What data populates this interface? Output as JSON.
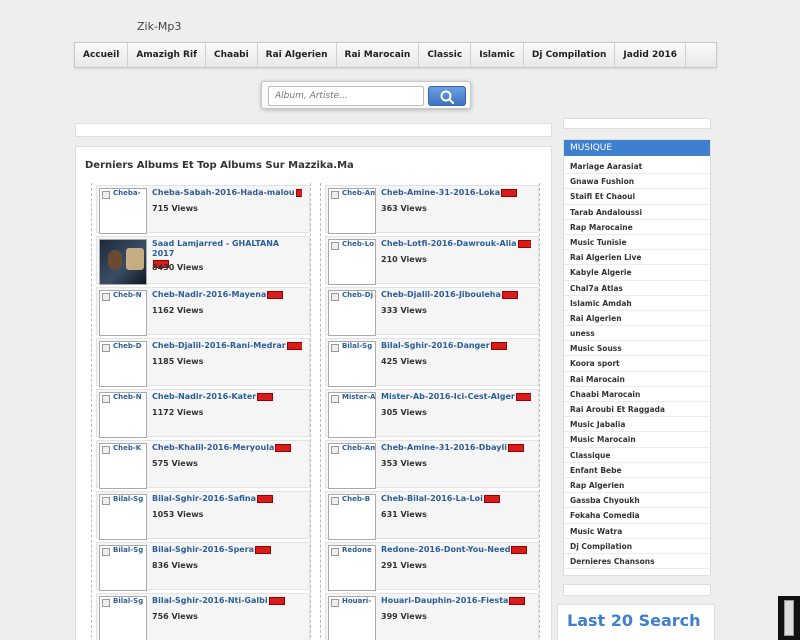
{
  "site_title": "Zik-Mp3",
  "nav": [
    "Accueil",
    "Amazigh Rif",
    "Chaabi",
    "Rai Algerien",
    "Rai Marocain",
    "Classic",
    "Islamic",
    "Dj Compilation",
    "Jadid 2016"
  ],
  "search": {
    "placeholder": "Album, Artiste...",
    "icon": "search-icon"
  },
  "main_heading": "Derniers Albums Et Top Albums Sur Mazzika.Ma",
  "left_items": [
    {
      "thumb": "Cheba-",
      "title": "Cheba-Sabah-2016-Hada-malou",
      "views": "715 Views"
    },
    {
      "thumb": "",
      "title": "Saad Lamjarred - GHALTANA 2017",
      "views": "8430 Views",
      "photo": true
    },
    {
      "thumb": "Cheb-N",
      "title": "Cheb-Nadir-2016-Mayena",
      "views": "1162 Views"
    },
    {
      "thumb": "Cheb-D",
      "title": "Cheb-Djalil-2016-Rani-Medrar",
      "views": "1185 Views"
    },
    {
      "thumb": "Cheb-N",
      "title": "Cheb-Nadir-2016-Kater",
      "views": "1172 Views"
    },
    {
      "thumb": "Cheb-K",
      "title": "Cheb-Khalil-2016-Meryoula",
      "views": "575 Views"
    },
    {
      "thumb": "Bilal-Sg",
      "title": "Bilal-Sghir-2016-Safina",
      "views": "1053 Views"
    },
    {
      "thumb": "Bilal-Sg",
      "title": "Bilal-Sghir-2016-Spera",
      "views": "836 Views"
    },
    {
      "thumb": "Bilal-Sg",
      "title": "Bilal-Sghir-2016-Nti-Galbi",
      "views": "756 Views"
    }
  ],
  "right_items": [
    {
      "thumb": "Cheb-Am",
      "title": "Cheb-Amine-31-2016-Loka",
      "views": "363 Views"
    },
    {
      "thumb": "Cheb-Lo",
      "title": "Cheb-Lotfi-2016-Dawrouk-Alia",
      "views": "210 Views"
    },
    {
      "thumb": "Cheb-Dj",
      "title": "Cheb-Djalil-2016-Jibouleha",
      "views": "333 Views"
    },
    {
      "thumb": "Bilal-Sg",
      "title": "Bilal-Sghir-2016-Danger",
      "views": "425 Views"
    },
    {
      "thumb": "Mister-A",
      "title": "Mister-Ab-2016-Ici-Cest-Alger",
      "views": "305 Views"
    },
    {
      "thumb": "Cheb-Am",
      "title": "Cheb-Amine-31-2016-Dbayli",
      "views": "353 Views"
    },
    {
      "thumb": "Cheb-B",
      "title": "Cheb-Bilal-2016-La-Loi",
      "views": "631 Views"
    },
    {
      "thumb": "Redone",
      "title": "Redone-2016-Dont-You-Need",
      "views": "291 Views"
    },
    {
      "thumb": "Houari-",
      "title": "Houari-Dauphin-2016-Fiesta",
      "views": "399 Views"
    }
  ],
  "sidebar": {
    "heading": "MUSIQUE",
    "items": [
      "Mariage Aarasiat",
      "Gnawa Fushion",
      "Staifi Et Chaoui",
      "Tarab Andaloussi",
      "Rap Marocaine",
      "Music Tunisie",
      "Rai Algerien Live",
      "Kabyle Algerie",
      "Chal7a Atlas",
      "Islamic Amdah",
      "Rai Algerien",
      "uness",
      "Music Souss",
      "Koora sport",
      "Rai Marocain",
      "Chaabi Marocain",
      "Rai Aroubi Et Raggada",
      "Music Jabalia",
      "Music Marocain",
      "Classique",
      "Enfant Bebe",
      "Rap Algerien",
      "Gassba Chyoukh",
      "Fokaha Comedia",
      "Music Watra",
      "Dj Compilation",
      "Dernieres Chansons"
    ]
  },
  "last_search_heading": "Last 20 Search",
  "colors": {
    "accent": "#3e7fd0",
    "link": "#2b5e9a",
    "new_badge": "#d71c1c"
  }
}
